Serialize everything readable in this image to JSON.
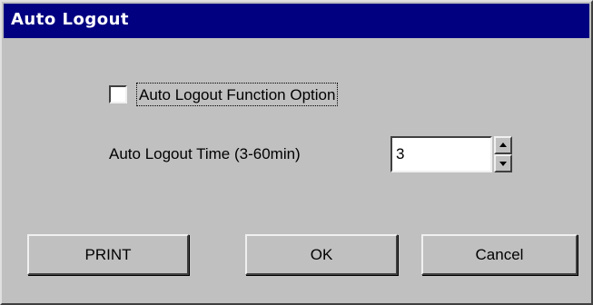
{
  "dialog": {
    "title": "Auto Logout"
  },
  "auto_logout_option": {
    "label": "Auto Logout Function Option",
    "checked": false
  },
  "auto_logout_time": {
    "label": "Auto Logout Time (3-60min)",
    "value": "3"
  },
  "buttons": {
    "print": "PRINT",
    "ok": "OK",
    "cancel": "Cancel"
  },
  "colors": {
    "titlebar": "#000080",
    "face": "#c0c0c0"
  },
  "icons": {
    "spin_up": "spin-up-arrow-icon",
    "spin_down": "spin-down-arrow-icon"
  }
}
